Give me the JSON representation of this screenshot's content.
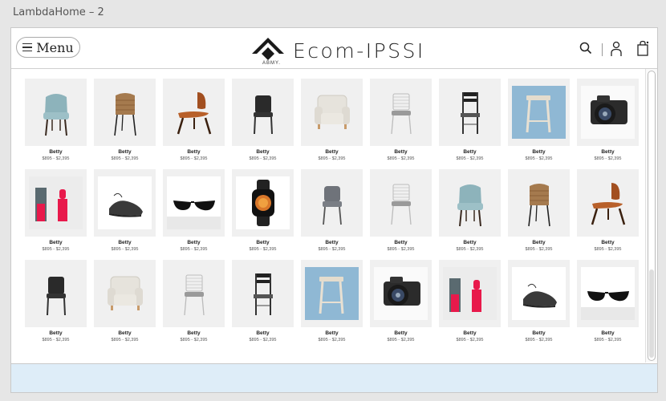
{
  "window": {
    "title": "LambdaHome – 2"
  },
  "header": {
    "menu_label": "Menu",
    "brand": "Ecom-IPSSI",
    "logo_sub": "ABMY.",
    "icons": [
      "search-icon",
      "user-icon",
      "shopping-bag-icon"
    ]
  },
  "products": [
    {
      "name": "Betty",
      "price": "$895 - $2,395",
      "kind": "chair-teal"
    },
    {
      "name": "Betty",
      "price": "$895 - $2,395",
      "kind": "chair-wicker"
    },
    {
      "name": "Betty",
      "price": "$895 - $2,395",
      "kind": "chair-wood"
    },
    {
      "name": "Betty",
      "price": "$895 - $2,395",
      "kind": "chair-black"
    },
    {
      "name": "Betty",
      "price": "$895 - $2,395",
      "kind": "armchair"
    },
    {
      "name": "Betty",
      "price": "$895 - $2,395",
      "kind": "chair-wire"
    },
    {
      "name": "Betty",
      "price": "$895 - $2,395",
      "kind": "chair-ladder"
    },
    {
      "name": "Betty",
      "price": "$895 - $2,395",
      "kind": "stool"
    },
    {
      "name": "Betty",
      "price": "$895 - $2,395",
      "kind": "camera"
    },
    {
      "name": "Betty",
      "price": "$895 - $2,395",
      "kind": "lipstick"
    },
    {
      "name": "Betty",
      "price": "$895 - $2,395",
      "kind": "sneaker"
    },
    {
      "name": "Betty",
      "price": "$895 - $2,395",
      "kind": "sunglasses"
    },
    {
      "name": "Betty",
      "price": "$895 - $2,395",
      "kind": "watch"
    },
    {
      "name": "Betty",
      "price": "$895 - $2,395",
      "kind": "chair-grey"
    },
    {
      "name": "Betty",
      "price": "$895 - $2,395",
      "kind": "chair-wire"
    },
    {
      "name": "Betty",
      "price": "$895 - $2,395",
      "kind": "chair-teal"
    },
    {
      "name": "Betty",
      "price": "$895 - $2,395",
      "kind": "chair-wicker"
    },
    {
      "name": "Betty",
      "price": "$895 - $2,395",
      "kind": "chair-wood"
    },
    {
      "name": "Betty",
      "price": "$895 - $2,395",
      "kind": "chair-black"
    },
    {
      "name": "Betty",
      "price": "$895 - $2,395",
      "kind": "armchair"
    },
    {
      "name": "Betty",
      "price": "$895 - $2,395",
      "kind": "chair-wire"
    },
    {
      "name": "Betty",
      "price": "$895 - $2,395",
      "kind": "chair-ladder"
    },
    {
      "name": "Betty",
      "price": "$895 - $2,395",
      "kind": "stool"
    },
    {
      "name": "Betty",
      "price": "$895 - $2,395",
      "kind": "camera"
    },
    {
      "name": "Betty",
      "price": "$895 - $2,395",
      "kind": "lipstick"
    },
    {
      "name": "Betty",
      "price": "$895 - $2,395",
      "kind": "sneaker"
    },
    {
      "name": "Betty",
      "price": "$895 - $2,395",
      "kind": "sunglasses"
    }
  ],
  "colors": {
    "footer_band": "#deedf8",
    "card_bg": "#f0f0f0",
    "lipstick": "#e8194b",
    "stool_bg": "#8fb8d4"
  }
}
